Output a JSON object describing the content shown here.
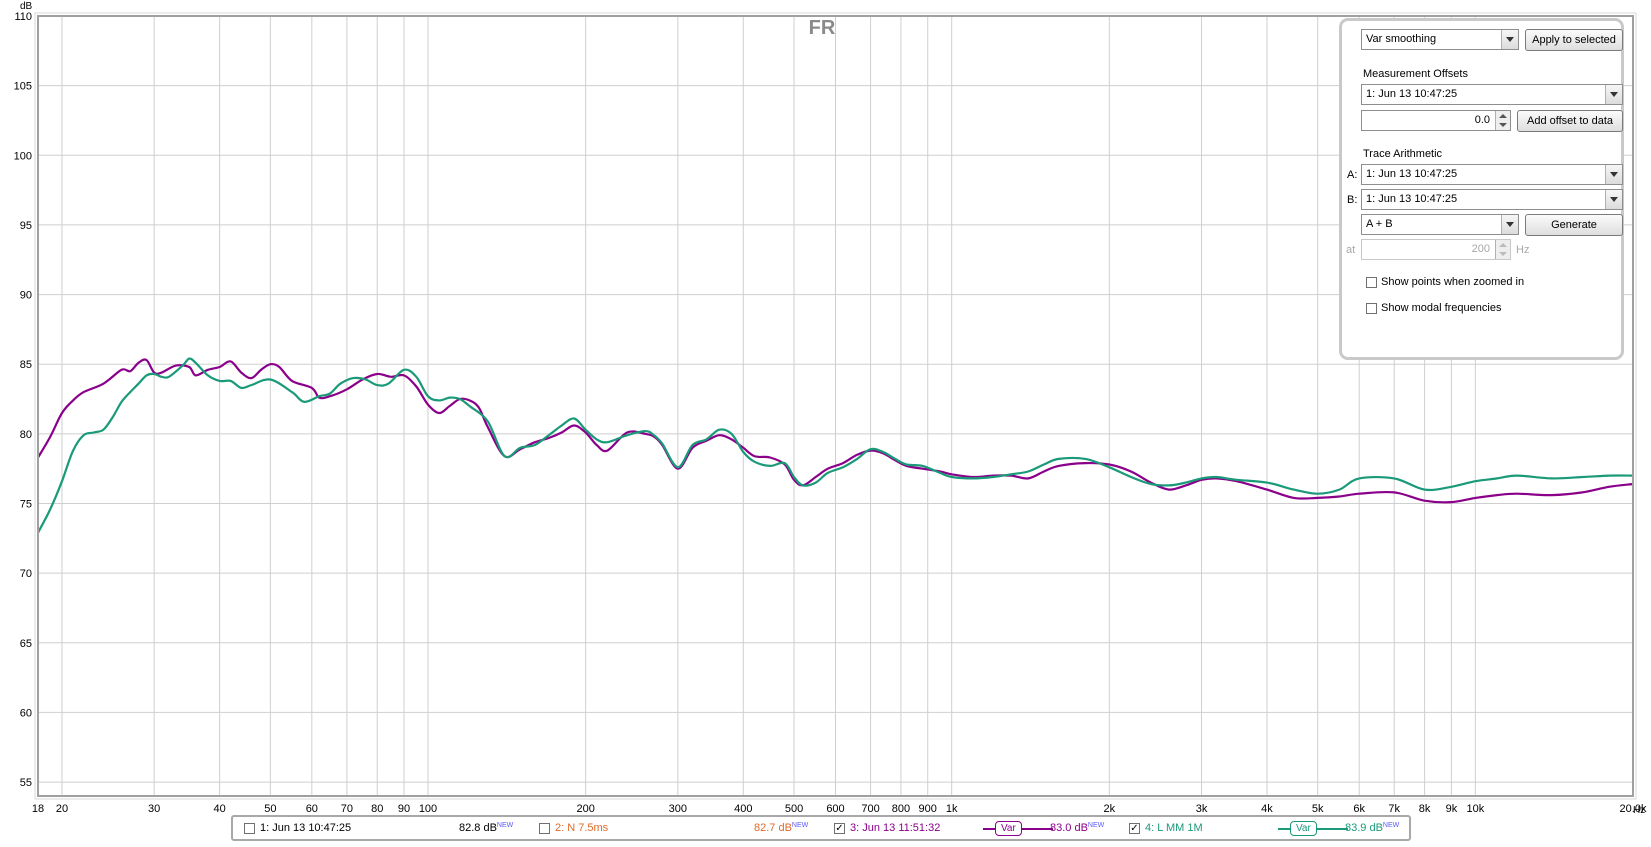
{
  "chart_data": {
    "type": "line",
    "title": "FR",
    "ylabel": "dB",
    "xlabel": "Hz",
    "x_scale": "log",
    "xlim": [
      18,
      20000
    ],
    "ylim": [
      54,
      110
    ],
    "x_ticks": [
      {
        "v": 18,
        "label": "18"
      },
      {
        "v": 20,
        "label": "20"
      },
      {
        "v": 30,
        "label": "30"
      },
      {
        "v": 40,
        "label": "40"
      },
      {
        "v": 50,
        "label": "50"
      },
      {
        "v": 60,
        "label": "60"
      },
      {
        "v": 70,
        "label": "70"
      },
      {
        "v": 80,
        "label": "80"
      },
      {
        "v": 90,
        "label": "90"
      },
      {
        "v": 100,
        "label": "100"
      },
      {
        "v": 200,
        "label": "200"
      },
      {
        "v": 300,
        "label": "300"
      },
      {
        "v": 400,
        "label": "400"
      },
      {
        "v": 500,
        "label": "500"
      },
      {
        "v": 600,
        "label": "600"
      },
      {
        "v": 700,
        "label": "700"
      },
      {
        "v": 800,
        "label": "800"
      },
      {
        "v": 900,
        "label": "900"
      },
      {
        "v": 1000,
        "label": "1k"
      },
      {
        "v": 2000,
        "label": "2k"
      },
      {
        "v": 3000,
        "label": "3k"
      },
      {
        "v": 4000,
        "label": "4k"
      },
      {
        "v": 5000,
        "label": "5k"
      },
      {
        "v": 6000,
        "label": "6k"
      },
      {
        "v": 7000,
        "label": "7k"
      },
      {
        "v": 8000,
        "label": "8k"
      },
      {
        "v": 9000,
        "label": "9k"
      },
      {
        "v": 10000,
        "label": "10k"
      },
      {
        "v": 20000,
        "label": "20.0k"
      }
    ],
    "y_ticks": [
      55,
      60,
      65,
      70,
      75,
      80,
      85,
      90,
      95,
      100,
      105,
      110
    ],
    "grid": true,
    "series": [
      {
        "name": "3: Jun 13 11:51:32",
        "color": "#8b008b",
        "points": [
          [
            18,
            78.3
          ],
          [
            19,
            79.8
          ],
          [
            20,
            81.5
          ],
          [
            21,
            82.4
          ],
          [
            22,
            83
          ],
          [
            24,
            83.6
          ],
          [
            26,
            84.6
          ],
          [
            27,
            84.5
          ],
          [
            28,
            85.1
          ],
          [
            29,
            85.3
          ],
          [
            30,
            84.4
          ],
          [
            31,
            84.4
          ],
          [
            33,
            84.9
          ],
          [
            35,
            84.8
          ],
          [
            36,
            84.2
          ],
          [
            38,
            84.6
          ],
          [
            40,
            84.8
          ],
          [
            42,
            85.2
          ],
          [
            44,
            84.4
          ],
          [
            46,
            84
          ],
          [
            48,
            84.6
          ],
          [
            50,
            85
          ],
          [
            52,
            84.8
          ],
          [
            55,
            83.8
          ],
          [
            60,
            83.3
          ],
          [
            62,
            82.6
          ],
          [
            65,
            82.7
          ],
          [
            70,
            83.2
          ],
          [
            75,
            83.9
          ],
          [
            80,
            84.3
          ],
          [
            85,
            84.1
          ],
          [
            90,
            84.2
          ],
          [
            95,
            83.4
          ],
          [
            100,
            82.1
          ],
          [
            105,
            81.5
          ],
          [
            110,
            82
          ],
          [
            115,
            82.5
          ],
          [
            120,
            82.4
          ],
          [
            125,
            81.9
          ],
          [
            130,
            80.5
          ],
          [
            140,
            78.4
          ],
          [
            150,
            78.9
          ],
          [
            160,
            79.4
          ],
          [
            170,
            79.7
          ],
          [
            180,
            80.1
          ],
          [
            190,
            80.6
          ],
          [
            200,
            80.1
          ],
          [
            210,
            79.2
          ],
          [
            220,
            78.8
          ],
          [
            240,
            80.1
          ],
          [
            260,
            80
          ],
          [
            270,
            79.8
          ],
          [
            280,
            79.2
          ],
          [
            300,
            77.5
          ],
          [
            320,
            79
          ],
          [
            340,
            79.5
          ],
          [
            360,
            79.9
          ],
          [
            380,
            79.6
          ],
          [
            400,
            79
          ],
          [
            420,
            78.4
          ],
          [
            450,
            78.3
          ],
          [
            480,
            77.8
          ],
          [
            500,
            76.7
          ],
          [
            520,
            76.3
          ],
          [
            550,
            76.9
          ],
          [
            580,
            77.5
          ],
          [
            620,
            77.9
          ],
          [
            660,
            78.5
          ],
          [
            700,
            78.8
          ],
          [
            740,
            78.6
          ],
          [
            780,
            78.1
          ],
          [
            820,
            77.7
          ],
          [
            880,
            77.5
          ],
          [
            950,
            77.3
          ],
          [
            1000,
            77.1
          ],
          [
            1100,
            76.9
          ],
          [
            1200,
            77
          ],
          [
            1300,
            77
          ],
          [
            1400,
            76.8
          ],
          [
            1500,
            77.3
          ],
          [
            1600,
            77.7
          ],
          [
            1800,
            77.9
          ],
          [
            2000,
            77.8
          ],
          [
            2200,
            77.3
          ],
          [
            2400,
            76.5
          ],
          [
            2600,
            76
          ],
          [
            2800,
            76.3
          ],
          [
            3000,
            76.7
          ],
          [
            3200,
            76.8
          ],
          [
            3500,
            76.6
          ],
          [
            4000,
            76
          ],
          [
            4500,
            75.4
          ],
          [
            5000,
            75.4
          ],
          [
            5500,
            75.5
          ],
          [
            6000,
            75.7
          ],
          [
            7000,
            75.8
          ],
          [
            8000,
            75.2
          ],
          [
            9000,
            75.1
          ],
          [
            10000,
            75.4
          ],
          [
            11000,
            75.6
          ],
          [
            12000,
            75.7
          ],
          [
            14000,
            75.6
          ],
          [
            16000,
            75.8
          ],
          [
            18000,
            76.2
          ],
          [
            20000,
            76.4
          ]
        ]
      },
      {
        "name": "4: L MM 1M",
        "color": "#1a9a78",
        "points": [
          [
            18,
            72.9
          ],
          [
            19,
            74.6
          ],
          [
            20,
            76.6
          ],
          [
            21,
            78.8
          ],
          [
            22,
            79.9
          ],
          [
            23,
            80.1
          ],
          [
            24,
            80.3
          ],
          [
            25,
            81.2
          ],
          [
            26,
            82.3
          ],
          [
            27,
            83
          ],
          [
            28,
            83.6
          ],
          [
            29,
            84.2
          ],
          [
            30,
            84.3
          ],
          [
            31,
            84.1
          ],
          [
            32,
            84.1
          ],
          [
            34,
            84.9
          ],
          [
            35,
            85.4
          ],
          [
            36,
            85.1
          ],
          [
            38,
            84.2
          ],
          [
            40,
            83.8
          ],
          [
            42,
            83.8
          ],
          [
            44,
            83.3
          ],
          [
            46,
            83.5
          ],
          [
            50,
            83.9
          ],
          [
            55,
            83
          ],
          [
            58,
            82.3
          ],
          [
            62,
            82.7
          ],
          [
            65,
            82.9
          ],
          [
            68,
            83.6
          ],
          [
            72,
            84
          ],
          [
            76,
            83.9
          ],
          [
            80,
            83.5
          ],
          [
            84,
            83.6
          ],
          [
            90,
            84.6
          ],
          [
            95,
            84.1
          ],
          [
            100,
            82.7
          ],
          [
            105,
            82.4
          ],
          [
            110,
            82.6
          ],
          [
            115,
            82.5
          ],
          [
            120,
            82
          ],
          [
            130,
            80.9
          ],
          [
            140,
            78.4
          ],
          [
            150,
            79
          ],
          [
            160,
            79.2
          ],
          [
            170,
            79.9
          ],
          [
            180,
            80.6
          ],
          [
            190,
            81.1
          ],
          [
            200,
            80.3
          ],
          [
            210,
            79.6
          ],
          [
            220,
            79.4
          ],
          [
            240,
            79.9
          ],
          [
            260,
            80.2
          ],
          [
            270,
            79.9
          ],
          [
            280,
            79.3
          ],
          [
            300,
            77.6
          ],
          [
            320,
            79.2
          ],
          [
            340,
            79.6
          ],
          [
            360,
            80.3
          ],
          [
            380,
            80
          ],
          [
            400,
            78.7
          ],
          [
            420,
            78
          ],
          [
            450,
            77.7
          ],
          [
            480,
            77.9
          ],
          [
            500,
            76.9
          ],
          [
            520,
            76.3
          ],
          [
            550,
            76.5
          ],
          [
            580,
            77.2
          ],
          [
            620,
            77.6
          ],
          [
            660,
            78.2
          ],
          [
            700,
            78.9
          ],
          [
            740,
            78.7
          ],
          [
            780,
            78.2
          ],
          [
            820,
            77.8
          ],
          [
            880,
            77.7
          ],
          [
            950,
            77.2
          ],
          [
            1000,
            76.9
          ],
          [
            1100,
            76.8
          ],
          [
            1200,
            76.9
          ],
          [
            1300,
            77.1
          ],
          [
            1400,
            77.3
          ],
          [
            1500,
            77.8
          ],
          [
            1600,
            78.2
          ],
          [
            1800,
            78.2
          ],
          [
            2000,
            77.6
          ],
          [
            2200,
            76.9
          ],
          [
            2400,
            76.4
          ],
          [
            2600,
            76.3
          ],
          [
            2800,
            76.5
          ],
          [
            3000,
            76.8
          ],
          [
            3200,
            76.9
          ],
          [
            3500,
            76.7
          ],
          [
            4000,
            76.5
          ],
          [
            4500,
            76
          ],
          [
            5000,
            75.7
          ],
          [
            5500,
            76
          ],
          [
            6000,
            76.8
          ],
          [
            7000,
            76.8
          ],
          [
            8000,
            76
          ],
          [
            9000,
            76.2
          ],
          [
            10000,
            76.6
          ],
          [
            11000,
            76.8
          ],
          [
            12000,
            77
          ],
          [
            14000,
            76.8
          ],
          [
            16000,
            76.9
          ],
          [
            18000,
            77
          ],
          [
            20000,
            77
          ]
        ]
      }
    ]
  },
  "panel": {
    "smoothing_value": "Var smoothing",
    "apply_label": "Apply to selected",
    "offsets_header": "Measurement Offsets",
    "offset_measurement": "1: Jun 13 10:47:25",
    "offset_value": "0.0",
    "add_offset_label": "Add offset to data",
    "arith_header": "Trace Arithmetic",
    "a_label": "A:",
    "a_value": "1: Jun 13 10:47:25",
    "b_label": "B:",
    "b_value": "1: Jun 13 10:47:25",
    "op_value": "A + B",
    "generate_label": "Generate",
    "at_label": "at",
    "at_value": "200",
    "at_unit": "Hz",
    "show_points_label": "Show points when zoomed in",
    "show_modal_label": "Show modal frequencies"
  },
  "legend": {
    "new_tag": "NEW",
    "var_label": "Var",
    "items": [
      {
        "label": "1: Jun 13 10:47:25",
        "level": "82.8 dB",
        "color": "#000000",
        "checked": false
      },
      {
        "label": "2: N 7.5ms",
        "level": "82.7 dB",
        "color": "#e06a2a",
        "checked": false
      },
      {
        "label": "3: Jun 13 11:51:32",
        "level": "83.0 dB",
        "color": "#8b008b",
        "checked": true
      },
      {
        "label": "4: L MM 1M",
        "level": "83.9 dB",
        "color": "#1a9a78",
        "checked": true
      }
    ]
  }
}
